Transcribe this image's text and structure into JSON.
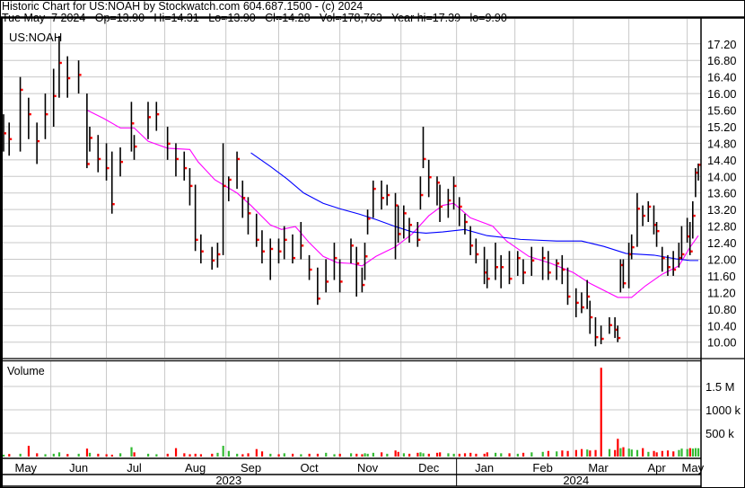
{
  "header": {
    "title": "Historic Chart for US:NOAH by Stockwatch.com 604.687.1500 - (c) 2024",
    "quote_line": "Tue May  7 2024   Op=13.90   Hi=14.31   Lo=13.90   Cl=14.28   Vol=178,763   Year hi=17.39   lo=9.90"
  },
  "chart_data": {
    "type": "ohlc",
    "symbol": "US:NOAH",
    "volume_label": "Volume",
    "x_unit": "trading day index",
    "xlim": [
      0,
      250
    ],
    "ylim": [
      9.6,
      17.5
    ],
    "price_ticks": [
      "17.20",
      "16.80",
      "16.40",
      "16.00",
      "15.60",
      "15.20",
      "14.80",
      "14.40",
      "14.00",
      "13.60",
      "13.20",
      "12.80",
      "12.40",
      "12.00",
      "11.60",
      "11.20",
      "10.80",
      "10.40",
      "10.00"
    ],
    "volume_ticks": [
      {
        "label": "1.5 M",
        "value": 1500000
      },
      {
        "label": "1000 k",
        "value": 1000000
      },
      {
        "label": "500 k",
        "value": 500000
      }
    ],
    "month_gridlines": [
      17,
      37,
      58,
      80,
      99,
      121,
      143,
      163,
      184,
      205,
      225,
      246
    ],
    "months": [
      {
        "label": "May",
        "day": 8
      },
      {
        "label": "Jun",
        "day": 27
      },
      {
        "label": "Jul",
        "day": 47
      },
      {
        "label": "Aug",
        "day": 69
      },
      {
        "label": "Sep",
        "day": 89
      },
      {
        "label": "Oct",
        "day": 110
      },
      {
        "label": "Nov",
        "day": 131
      },
      {
        "label": "Dec",
        "day": 153
      },
      {
        "label": "Jan",
        "day": 173
      },
      {
        "label": "Feb",
        "day": 194
      },
      {
        "label": "Mar",
        "day": 214
      },
      {
        "label": "Apr",
        "day": 235
      },
      {
        "label": "May",
        "day": 248
      }
    ],
    "years": [
      {
        "label": "2023",
        "day": 81
      },
      {
        "label": "2024",
        "day": 206
      }
    ],
    "year_boundary_day": 163,
    "colors": {
      "bar": "#000000",
      "close_tick": "#ff0000",
      "ma_short": "#ff00ff",
      "ma_long": "#0000ff",
      "vol_up": "#33bb33",
      "vol_down": "#ff0000",
      "grid": "#c8c8c8"
    },
    "bars_fields": [
      "day",
      "high",
      "low",
      "close"
    ],
    "bars": [
      [
        0,
        15.5,
        14.6,
        15.04
      ],
      [
        2,
        15.3,
        14.5,
        14.9
      ],
      [
        6,
        16.4,
        14.6,
        16.09
      ],
      [
        9,
        15.9,
        14.9,
        15.5
      ],
      [
        12,
        15.3,
        14.3,
        14.85
      ],
      [
        15,
        16.0,
        14.9,
        15.5
      ],
      [
        18,
        16.6,
        15.2,
        15.94
      ],
      [
        20,
        17.39,
        15.9,
        16.74
      ],
      [
        23,
        16.9,
        15.9,
        16.37
      ],
      [
        27,
        16.8,
        16.0,
        16.45
      ],
      [
        30,
        16.0,
        14.2,
        14.3
      ],
      [
        31,
        15.2,
        14.6,
        14.93
      ],
      [
        34,
        15.0,
        14.1,
        14.42
      ],
      [
        37,
        14.8,
        13.9,
        14.2
      ],
      [
        39,
        14.6,
        13.1,
        13.33
      ],
      [
        42,
        14.7,
        14.0,
        14.35
      ],
      [
        46,
        15.8,
        14.6,
        15.28
      ],
      [
        47,
        15.0,
        14.4,
        14.72
      ],
      [
        52,
        15.8,
        14.9,
        15.43
      ],
      [
        55,
        15.8,
        15.1,
        15.5
      ],
      [
        59,
        15.2,
        14.4,
        14.79
      ],
      [
        62,
        14.8,
        14.0,
        14.42
      ],
      [
        65,
        14.6,
        13.9,
        14.2
      ],
      [
        67,
        14.2,
        13.3,
        13.77
      ],
      [
        69,
        13.8,
        12.2,
        12.47
      ],
      [
        71,
        12.6,
        11.9,
        12.19
      ],
      [
        75,
        12.3,
        11.75,
        11.97
      ],
      [
        77,
        12.4,
        11.8,
        12.12
      ],
      [
        79,
        14.8,
        12.1,
        13.77
      ],
      [
        81,
        14.0,
        13.4,
        13.92
      ],
      [
        84,
        14.6,
        13.7,
        14.42
      ],
      [
        86,
        13.9,
        13.0,
        13.48
      ],
      [
        88,
        13.5,
        12.6,
        13.11
      ],
      [
        91,
        13.1,
        12.3,
        12.47
      ],
      [
        93,
        12.7,
        11.9,
        12.19
      ],
      [
        96,
        12.5,
        11.5,
        12.25
      ],
      [
        99,
        12.5,
        11.9,
        12.19
      ],
      [
        101,
        12.8,
        12.0,
        12.47
      ],
      [
        104,
        12.6,
        11.9,
        12.03
      ],
      [
        107,
        12.9,
        12.0,
        12.33
      ],
      [
        110,
        12.1,
        11.5,
        11.75
      ],
      [
        113,
        11.8,
        10.9,
        11.05
      ],
      [
        116,
        12.0,
        11.2,
        11.46
      ],
      [
        119,
        12.4,
        11.5,
        12.03
      ],
      [
        121,
        12.0,
        11.2,
        11.46
      ],
      [
        125,
        12.5,
        11.9,
        12.33
      ],
      [
        127,
        12.3,
        11.1,
        11.9
      ],
      [
        129,
        11.8,
        11.2,
        11.38
      ],
      [
        130,
        12.4,
        11.5,
        12.07
      ],
      [
        131,
        13.2,
        12.6,
        12.98
      ],
      [
        133,
        13.9,
        13.0,
        13.7
      ],
      [
        136,
        13.9,
        13.2,
        13.48
      ],
      [
        138,
        13.8,
        13.3,
        13.55
      ],
      [
        141,
        13.6,
        12.0,
        13.3
      ],
      [
        142,
        13.3,
        12.4,
        12.61
      ],
      [
        144,
        13.3,
        12.5,
        13.11
      ],
      [
        146,
        13.0,
        12.4,
        12.83
      ],
      [
        149,
        12.9,
        12.3,
        12.47
      ],
      [
        150,
        14.0,
        13.2,
        13.55
      ],
      [
        151,
        15.2,
        14.2,
        14.42
      ],
      [
        153,
        14.4,
        13.5,
        13.98
      ],
      [
        156,
        14.0,
        13.3,
        13.85
      ],
      [
        157,
        13.8,
        12.9,
        13.27
      ],
      [
        160,
        13.7,
        13.0,
        13.42
      ],
      [
        162,
        14.0,
        13.2,
        13.77
      ],
      [
        164,
        13.5,
        12.8,
        13.27
      ],
      [
        166,
        13.1,
        12.6,
        12.9
      ],
      [
        168,
        12.8,
        12.1,
        12.33
      ],
      [
        170,
        12.5,
        11.9,
        12.12
      ],
      [
        173,
        12.3,
        11.4,
        11.68
      ],
      [
        174,
        12.0,
        11.3,
        11.53
      ],
      [
        177,
        12.4,
        11.5,
        11.81
      ],
      [
        179,
        12.1,
        11.3,
        11.81
      ],
      [
        182,
        12.2,
        11.4,
        11.53
      ],
      [
        185,
        12.2,
        11.6,
        12.03
      ],
      [
        187,
        12.0,
        11.4,
        11.68
      ],
      [
        190,
        12.3,
        11.6,
        11.97
      ],
      [
        194,
        12.3,
        11.5,
        12.03
      ],
      [
        196,
        12.2,
        11.5,
        11.68
      ],
      [
        199,
        12.0,
        11.5,
        11.9
      ],
      [
        201,
        12.1,
        11.4,
        11.75
      ],
      [
        203,
        11.8,
        10.9,
        11.1
      ],
      [
        206,
        11.3,
        10.6,
        10.95
      ],
      [
        208,
        11.2,
        10.7,
        10.84
      ],
      [
        210,
        11.5,
        10.8,
        11.1
      ],
      [
        211,
        11.0,
        10.2,
        10.6
      ],
      [
        213,
        10.6,
        9.9,
        10.12
      ],
      [
        215,
        10.4,
        9.95,
        10.08
      ],
      [
        218,
        10.6,
        10.2,
        10.41
      ],
      [
        220,
        10.6,
        10.1,
        10.3
      ],
      [
        221,
        10.4,
        10.0,
        10.1
      ],
      [
        222,
        12.0,
        11.2,
        11.86
      ],
      [
        223,
        12.0,
        11.3,
        11.42
      ],
      [
        225,
        12.4,
        11.3,
        12.12
      ],
      [
        226,
        12.6,
        12.0,
        12.29
      ],
      [
        228,
        13.6,
        12.3,
        13.22
      ],
      [
        230,
        13.3,
        12.8,
        13.05
      ],
      [
        232,
        13.4,
        12.9,
        13.27
      ],
      [
        234,
        13.3,
        12.6,
        12.83
      ],
      [
        235,
        12.9,
        12.3,
        12.68
      ],
      [
        237,
        12.3,
        11.7,
        12.03
      ],
      [
        239,
        12.1,
        11.6,
        11.81
      ],
      [
        241,
        12.2,
        11.6,
        11.75
      ],
      [
        243,
        12.4,
        11.8,
        12.03
      ],
      [
        244,
        12.8,
        12.0,
        12.12
      ],
      [
        246,
        13.0,
        12.4,
        12.55
      ],
      [
        247,
        12.9,
        12.1,
        12.19
      ],
      [
        248,
        13.4,
        12.5,
        13.05
      ],
      [
        249,
        14.2,
        13.5,
        14.09
      ],
      [
        250,
        14.31,
        13.9,
        14.28
      ]
    ],
    "volume_k": [
      40,
      55,
      60,
      230,
      70,
      50,
      60,
      90,
      55,
      60,
      170,
      80,
      60,
      50,
      40,
      70,
      200,
      90,
      60,
      50,
      60,
      180,
      70,
      50,
      60,
      50,
      60,
      80,
      230,
      120,
      60,
      50,
      70,
      160,
      110,
      60,
      50,
      70,
      60,
      50,
      60,
      60,
      80,
      50,
      60,
      70,
      60,
      50,
      70,
      60,
      80,
      90,
      60,
      130,
      100,
      70,
      60,
      80,
      90,
      70,
      60,
      80,
      90,
      70,
      60,
      60,
      70,
      80,
      60,
      60,
      90,
      80,
      70,
      70,
      60,
      80,
      90,
      100,
      120,
      110,
      130,
      120,
      140,
      160,
      150,
      130,
      140,
      1900,
      160,
      140,
      380,
      180,
      200,
      170,
      150,
      140,
      180,
      100,
      120,
      90,
      120,
      130,
      110,
      140,
      170,
      160,
      180,
      170,
      180,
      178
    ],
    "ma_short": [
      [
        30,
        15.6
      ],
      [
        36,
        15.4
      ],
      [
        42,
        15.17
      ],
      [
        47,
        15.17
      ],
      [
        52,
        14.85
      ],
      [
        59,
        14.68
      ],
      [
        67,
        14.65
      ],
      [
        70,
        14.35
      ],
      [
        76,
        13.92
      ],
      [
        84,
        13.6
      ],
      [
        89,
        13.3
      ],
      [
        96,
        12.83
      ],
      [
        100,
        12.72
      ],
      [
        105,
        12.79
      ],
      [
        110,
        12.4
      ],
      [
        115,
        12.07
      ],
      [
        120,
        11.92
      ],
      [
        125,
        11.9
      ],
      [
        129,
        11.84
      ],
      [
        134,
        12.07
      ],
      [
        141,
        12.3
      ],
      [
        147,
        12.61
      ],
      [
        153,
        13.05
      ],
      [
        158,
        13.3
      ],
      [
        162,
        13.35
      ],
      [
        168,
        13.0
      ],
      [
        176,
        12.8
      ],
      [
        181,
        12.44
      ],
      [
        189,
        12.07
      ],
      [
        197,
        11.9
      ],
      [
        205,
        11.68
      ],
      [
        211,
        11.42
      ],
      [
        221,
        11.08
      ],
      [
        226,
        11.08
      ],
      [
        231,
        11.36
      ],
      [
        237,
        11.64
      ],
      [
        243,
        11.84
      ],
      [
        247,
        12.29
      ],
      [
        250,
        12.57
      ]
    ],
    "ma_long": [
      [
        89,
        14.57
      ],
      [
        96,
        14.24
      ],
      [
        102,
        13.94
      ],
      [
        108,
        13.6
      ],
      [
        115,
        13.35
      ],
      [
        121,
        13.22
      ],
      [
        128,
        13.09
      ],
      [
        134,
        12.96
      ],
      [
        141,
        12.79
      ],
      [
        147,
        12.66
      ],
      [
        152,
        12.63
      ],
      [
        158,
        12.66
      ],
      [
        166,
        12.72
      ],
      [
        174,
        12.57
      ],
      [
        186,
        12.48
      ],
      [
        199,
        12.44
      ],
      [
        208,
        12.44
      ],
      [
        216,
        12.31
      ],
      [
        224,
        12.14
      ],
      [
        234,
        12.1
      ],
      [
        242,
        12.01
      ],
      [
        247,
        11.97
      ],
      [
        250,
        11.97
      ]
    ]
  }
}
